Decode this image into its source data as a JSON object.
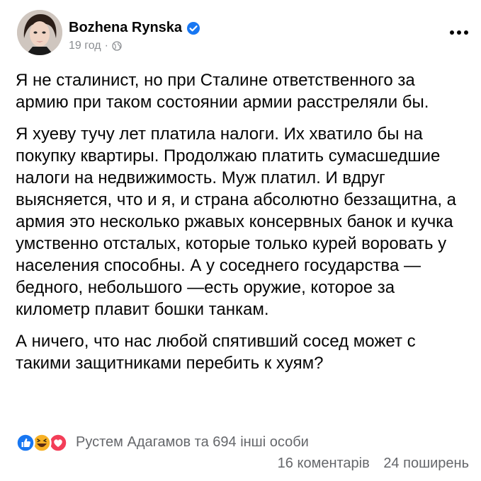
{
  "post": {
    "author_name": "Bozhena Rynska",
    "verified": true,
    "time": "19 год",
    "separator": "·",
    "audience_icon": "globe-icon",
    "more_icon": "more-options-icon",
    "paragraphs": [
      "Я не сталинист, но при Сталине ответственного за армию при таком состоянии армии расстреляли бы.",
      "Я хуеву тучу лет платила налоги. Их хватило бы на покупку квартиры. Продолжаю платить сумасшедшие налоги на недвижимость. Муж платил. И вдруг выясняется, что и я, и страна абсолютно беззащитна, а армия это несколько ржавых консервных банок и кучка умственно отсталых, которые только курей воровать у населения способны. А у соседнего государства — бедного, небольшого —есть оружие, которое за километр плавит бошки танкам.",
      "А ничего, что нас любой спятивший сосед может с такими защитниками перебить к хуям?"
    ]
  },
  "reactions": {
    "icons": [
      "like-icon",
      "haha-icon",
      "love-icon"
    ],
    "people_text": "Рустем Адагамов та 694 інші особи",
    "comments": "16 коментарів",
    "shares": "24 поширень"
  },
  "colors": {
    "like": "#1877f2",
    "haha": "#f7b125",
    "love": "#f33e58",
    "verified": "#1877f2",
    "secondary_text": "#65676b"
  }
}
